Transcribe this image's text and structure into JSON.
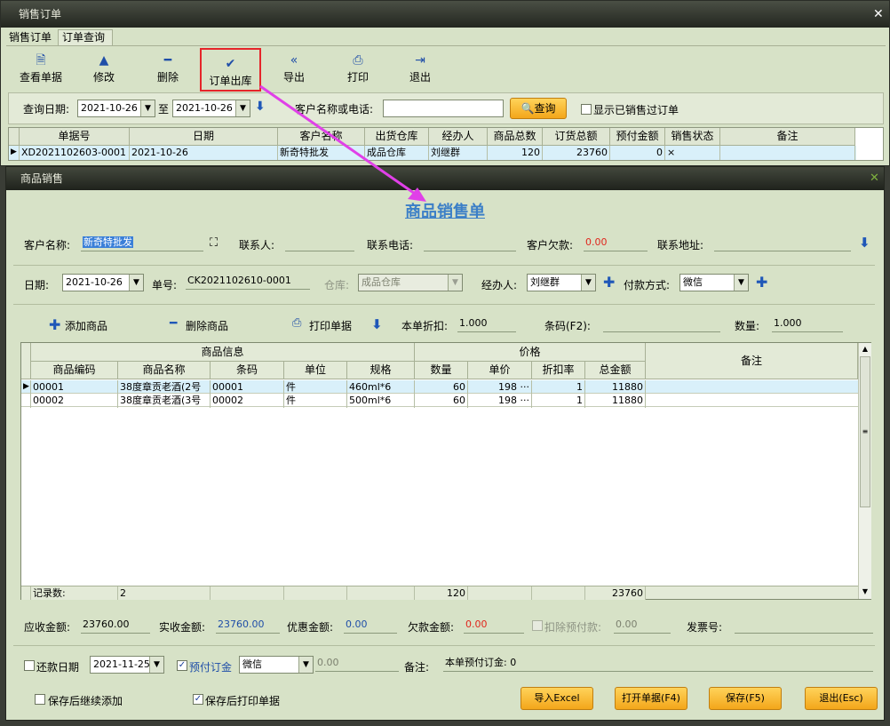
{
  "order_window": {
    "title": "销售订单",
    "tabs": [
      "销售订单",
      "订单查询"
    ],
    "toolbar": {
      "view": "查看单据",
      "edit": "修改",
      "delete": "删除",
      "outbound": "订单出库",
      "export": "导出",
      "print": "打印",
      "exit": "退出"
    },
    "query": {
      "date_label": "查询日期:",
      "date_from": "2021-10-26",
      "to_label": "至",
      "date_to": "2021-10-26",
      "customer_label": "客户名称或电话:",
      "customer_value": "",
      "search_button": "查询",
      "show_sold_label": "显示已销售过订单"
    },
    "grid": {
      "headers": [
        "单据号",
        "日期",
        "客户名称",
        "出货仓库",
        "经办人",
        "商品总数",
        "订货总额",
        "预付金额",
        "销售状态",
        "备注"
      ],
      "rows": [
        [
          "XD2021102603-0001",
          "2021-10-26",
          "新奇特批发",
          "成品仓库",
          "刘继群",
          "120",
          "23760",
          "0",
          "×",
          ""
        ]
      ]
    }
  },
  "sale_window": {
    "title": "商品销售",
    "form_title": "商品销售单",
    "customer": {
      "name_label": "客户名称:",
      "name_value": "新奇特批发",
      "contact_label": "联系人:",
      "contact_value": "",
      "phone_label": "联系电话:",
      "phone_value": "",
      "debt_label": "客户欠款:",
      "debt_value": "0.00",
      "address_label": "联系地址:",
      "address_value": ""
    },
    "meta": {
      "date_label": "日期:",
      "date_value": "2021-10-26",
      "no_label": "单号:",
      "no_value": "CK2021102610-0001",
      "warehouse_label": "仓库:",
      "warehouse_value": "成品仓库",
      "handler_label": "经办人:",
      "handler_value": "刘继群",
      "payment_label": "付款方式:",
      "payment_value": "微信"
    },
    "actions": {
      "add": "添加商品",
      "remove": "删除商品",
      "print": "打印单据",
      "discount_label": "本单折扣:",
      "discount_value": "1.000",
      "barcode_label": "条码(F2):",
      "barcode_value": "",
      "qty_label": "数量:",
      "qty_value": "1.000"
    },
    "grid": {
      "group_info": "商品信息",
      "group_price": "价格",
      "remark": "备注",
      "headers": [
        "商品编码",
        "商品名称",
        "条码",
        "单位",
        "规格",
        "数量",
        "单价",
        "折扣率",
        "总金额"
      ],
      "rows": [
        [
          "00001",
          "38度章贡老酒(2号",
          "00001",
          "件",
          "460ml*6",
          "60",
          "198 ···",
          "1",
          "11880"
        ],
        [
          "00002",
          "38度章贡老酒(3号",
          "00002",
          "件",
          "500ml*6",
          "60",
          "198 ···",
          "1",
          "11880"
        ]
      ],
      "footer": {
        "label": "记录数:",
        "count": "2",
        "qty_total": "120",
        "amount_total": "23760"
      }
    },
    "totals": {
      "receivable_label": "应收金额:",
      "receivable": "23760.00",
      "received_label": "实收金额:",
      "received": "23760.00",
      "discount_label": "优惠金额:",
      "discount": "0.00",
      "owed_label": "欠款金额:",
      "owed": "0.00",
      "deduct_label": "扣除预付款:",
      "deduct": "0.00",
      "invoice_label": "发票号:",
      "invoice": ""
    },
    "bottom": {
      "repay_label": "还款日期",
      "repay_date": "2021-11-25",
      "prepay_label": "预付订金",
      "prepay_method": "微信",
      "prepay_amount": "0.00",
      "note_label": "备注:",
      "note_value": "本单预付订金: 0",
      "continue_label": "保存后继续添加",
      "print_after_label": "保存后打印单据"
    },
    "buttons": {
      "import": "导入Excel",
      "open": "打开单据(F4)",
      "save": "保存(F5)",
      "exit": "退出(Esc)"
    }
  },
  "colors": {
    "accent_red": "#e5252a",
    "arrow": "#e040e8",
    "title_blue": "#3b7fc7",
    "debt_red": "#e0261d",
    "value_blue": "#1f4ea8",
    "button_orange": "#f3a61a"
  }
}
